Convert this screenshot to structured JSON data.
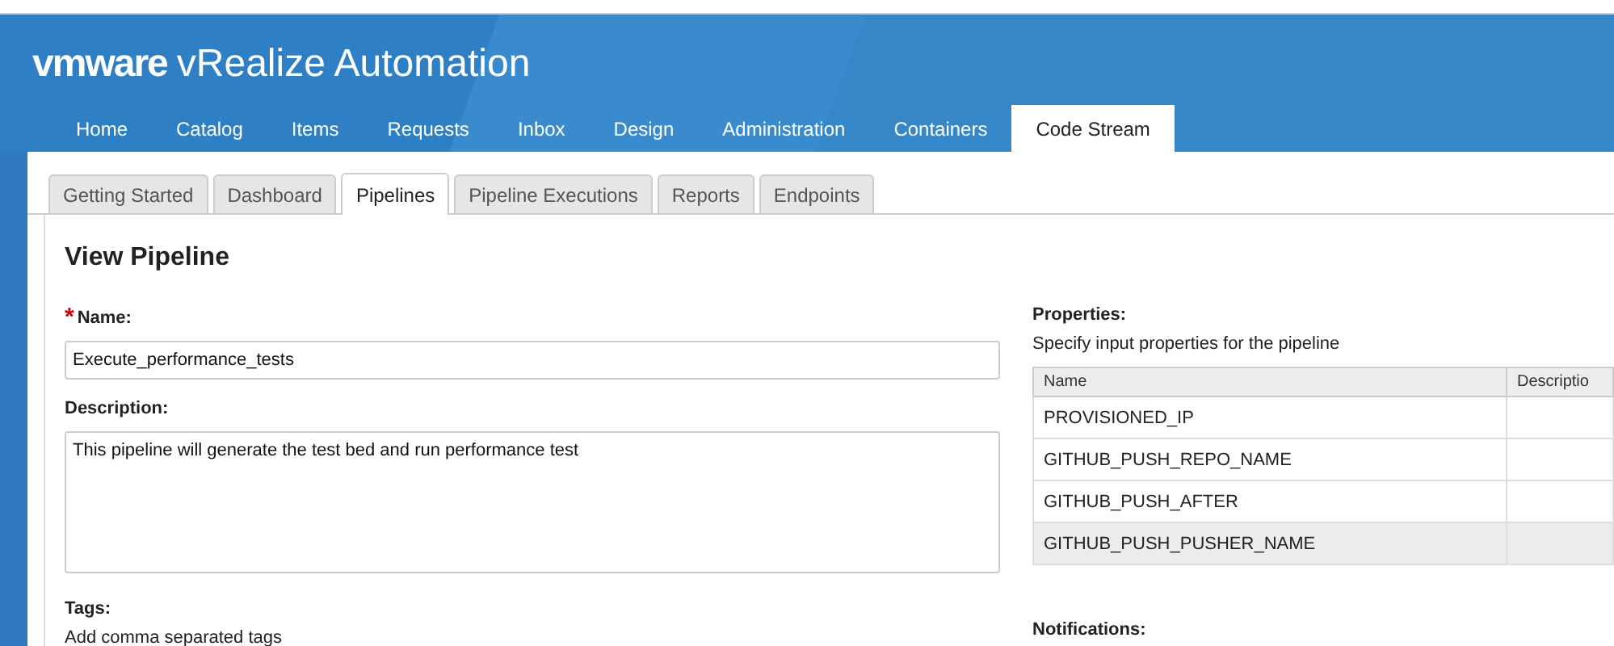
{
  "header": {
    "brand": "vmware",
    "product": "vRealize",
    "product_suffix": "Automation"
  },
  "nav": [
    {
      "label": "Home",
      "selected": false
    },
    {
      "label": "Catalog",
      "selected": false
    },
    {
      "label": "Items",
      "selected": false
    },
    {
      "label": "Requests",
      "selected": false
    },
    {
      "label": "Inbox",
      "selected": false
    },
    {
      "label": "Design",
      "selected": false
    },
    {
      "label": "Administration",
      "selected": false
    },
    {
      "label": "Containers",
      "selected": false
    },
    {
      "label": "Code Stream",
      "selected": true
    }
  ],
  "tabs": [
    {
      "label": "Getting Started",
      "selected": false
    },
    {
      "label": "Dashboard",
      "selected": false
    },
    {
      "label": "Pipelines",
      "selected": true
    },
    {
      "label": "Pipeline Executions",
      "selected": false
    },
    {
      "label": "Reports",
      "selected": false
    },
    {
      "label": "Endpoints",
      "selected": false
    }
  ],
  "page_title": "View Pipeline",
  "form": {
    "name_label": "Name:",
    "required_mark": "*",
    "name_value": "Execute_performance_tests",
    "description_label": "Description:",
    "description_value": "This pipeline will generate the test bed and run performance test",
    "tags_label": "Tags:",
    "tags_hint": "Add comma separated tags"
  },
  "properties": {
    "label": "Properties:",
    "hint": "Specify input properties for the pipeline",
    "columns": [
      "Name",
      "Descriptio"
    ],
    "rows": [
      {
        "name": "PROVISIONED_IP",
        "selected": false
      },
      {
        "name": "GITHUB_PUSH_REPO_NAME",
        "selected": false
      },
      {
        "name": "GITHUB_PUSH_AFTER",
        "selected": false
      },
      {
        "name": "GITHUB_PUSH_PUSHER_NAME",
        "selected": true
      }
    ]
  },
  "notifications": {
    "label": "Notifications:"
  }
}
